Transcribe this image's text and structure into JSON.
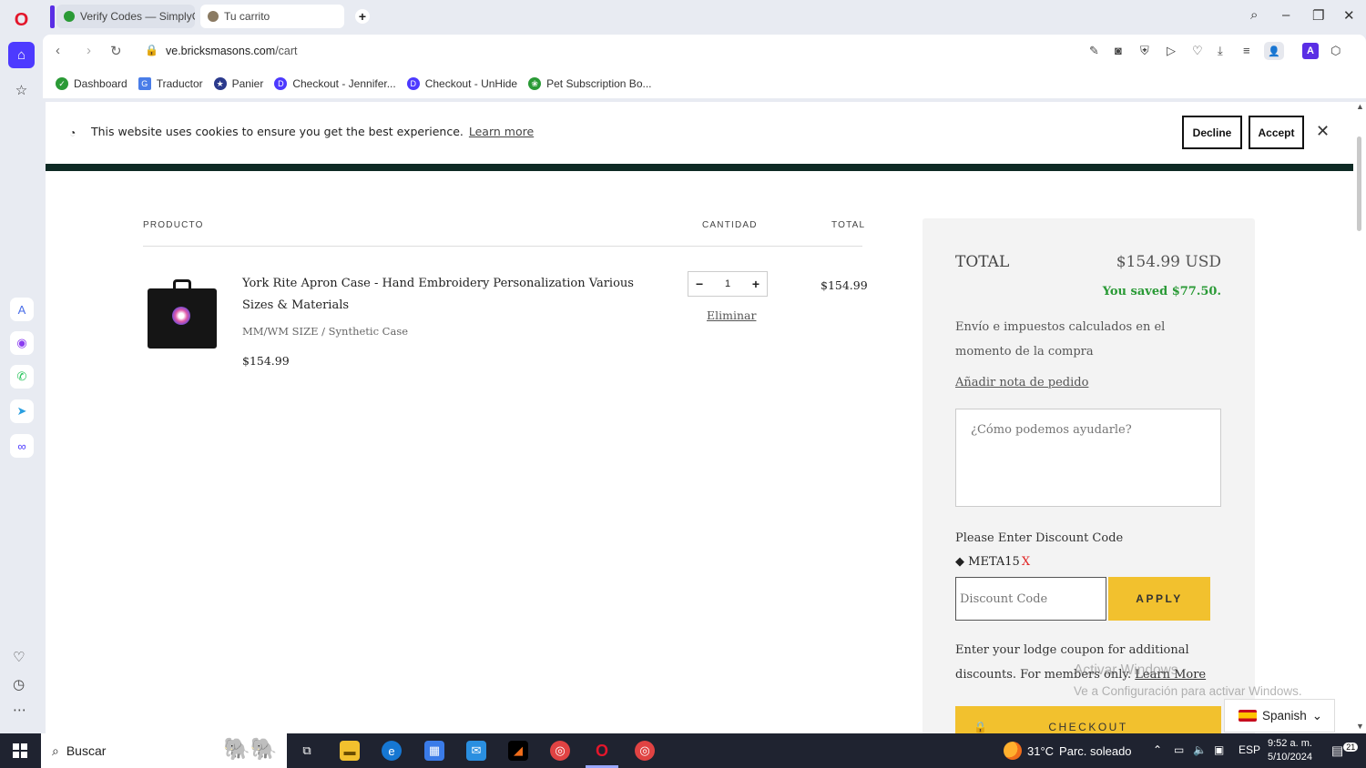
{
  "browser": {
    "tabs": [
      {
        "label": "Verify Codes — SimplyCo"
      },
      {
        "label": "Tu carrito"
      }
    ],
    "new_tab": "+",
    "url_domain": "ve.bricksmasons.com",
    "url_path": "/cart",
    "bookmarks": [
      {
        "label": "Dashboard",
        "icon": "dashboard-icon",
        "color": "#2a9a36"
      },
      {
        "label": "Traductor",
        "icon": "translate-icon",
        "color": "#4a7de8"
      },
      {
        "label": "Panier",
        "icon": "star-badge-icon",
        "color": "#2b3a8c"
      },
      {
        "label": "Checkout - Jennifer...",
        "icon": "checkout-icon",
        "color": "#4d3aff"
      },
      {
        "label": "Checkout - UnHide",
        "icon": "checkout-icon",
        "color": "#4d3aff"
      },
      {
        "label": "Pet Subscription Bo...",
        "icon": "paw-icon",
        "color": "#2a9a36"
      }
    ]
  },
  "cookie_banner": {
    "text": "This website uses cookies to ensure you get the best experience.",
    "learn_more": "Learn more",
    "decline": "Decline",
    "accept": "Accept"
  },
  "cart": {
    "headers": {
      "product": "PRODUCTO",
      "quantity": "CANTIDAD",
      "total": "TOTAL"
    },
    "item": {
      "name": "York Rite Apron Case - Hand Embroidery Personalization Various Sizes & Materials",
      "variant": "MM/WM SIZE / Synthetic Case",
      "price": "$154.99",
      "quantity": "1",
      "remove": "Eliminar",
      "line_total": "$154.99"
    }
  },
  "summary": {
    "total_label": "TOTAL",
    "total_amount": "$154.99 USD",
    "saved": "You saved $77.50.",
    "shipping_note": "Envío e impuestos calculados en el momento de la compra",
    "add_note": "Añadir nota de pedido",
    "note_placeholder": "¿Cómo podemos ayudarle?",
    "discount_label": "Please Enter Discount Code",
    "applied_code": "META15",
    "remove_code": "X",
    "discount_placeholder": "Discount Code",
    "apply": "APPLY",
    "lodge_text": "Enter your lodge coupon for additional discounts. For members only.",
    "lodge_link": "Learn More",
    "checkout": "CHECKOUT"
  },
  "language_selector": {
    "label": "Spanish"
  },
  "windows_watermark": {
    "line1": "Activar Windows",
    "line2": "Ve a Configuración para activar Windows."
  },
  "taskbar": {
    "search": "Buscar",
    "weather_temp": "31°C",
    "weather_desc": "Parc. soleado",
    "lang": "ESP",
    "time": "9:52 a. m.",
    "date": "5/10/2024",
    "notifications": "21"
  }
}
